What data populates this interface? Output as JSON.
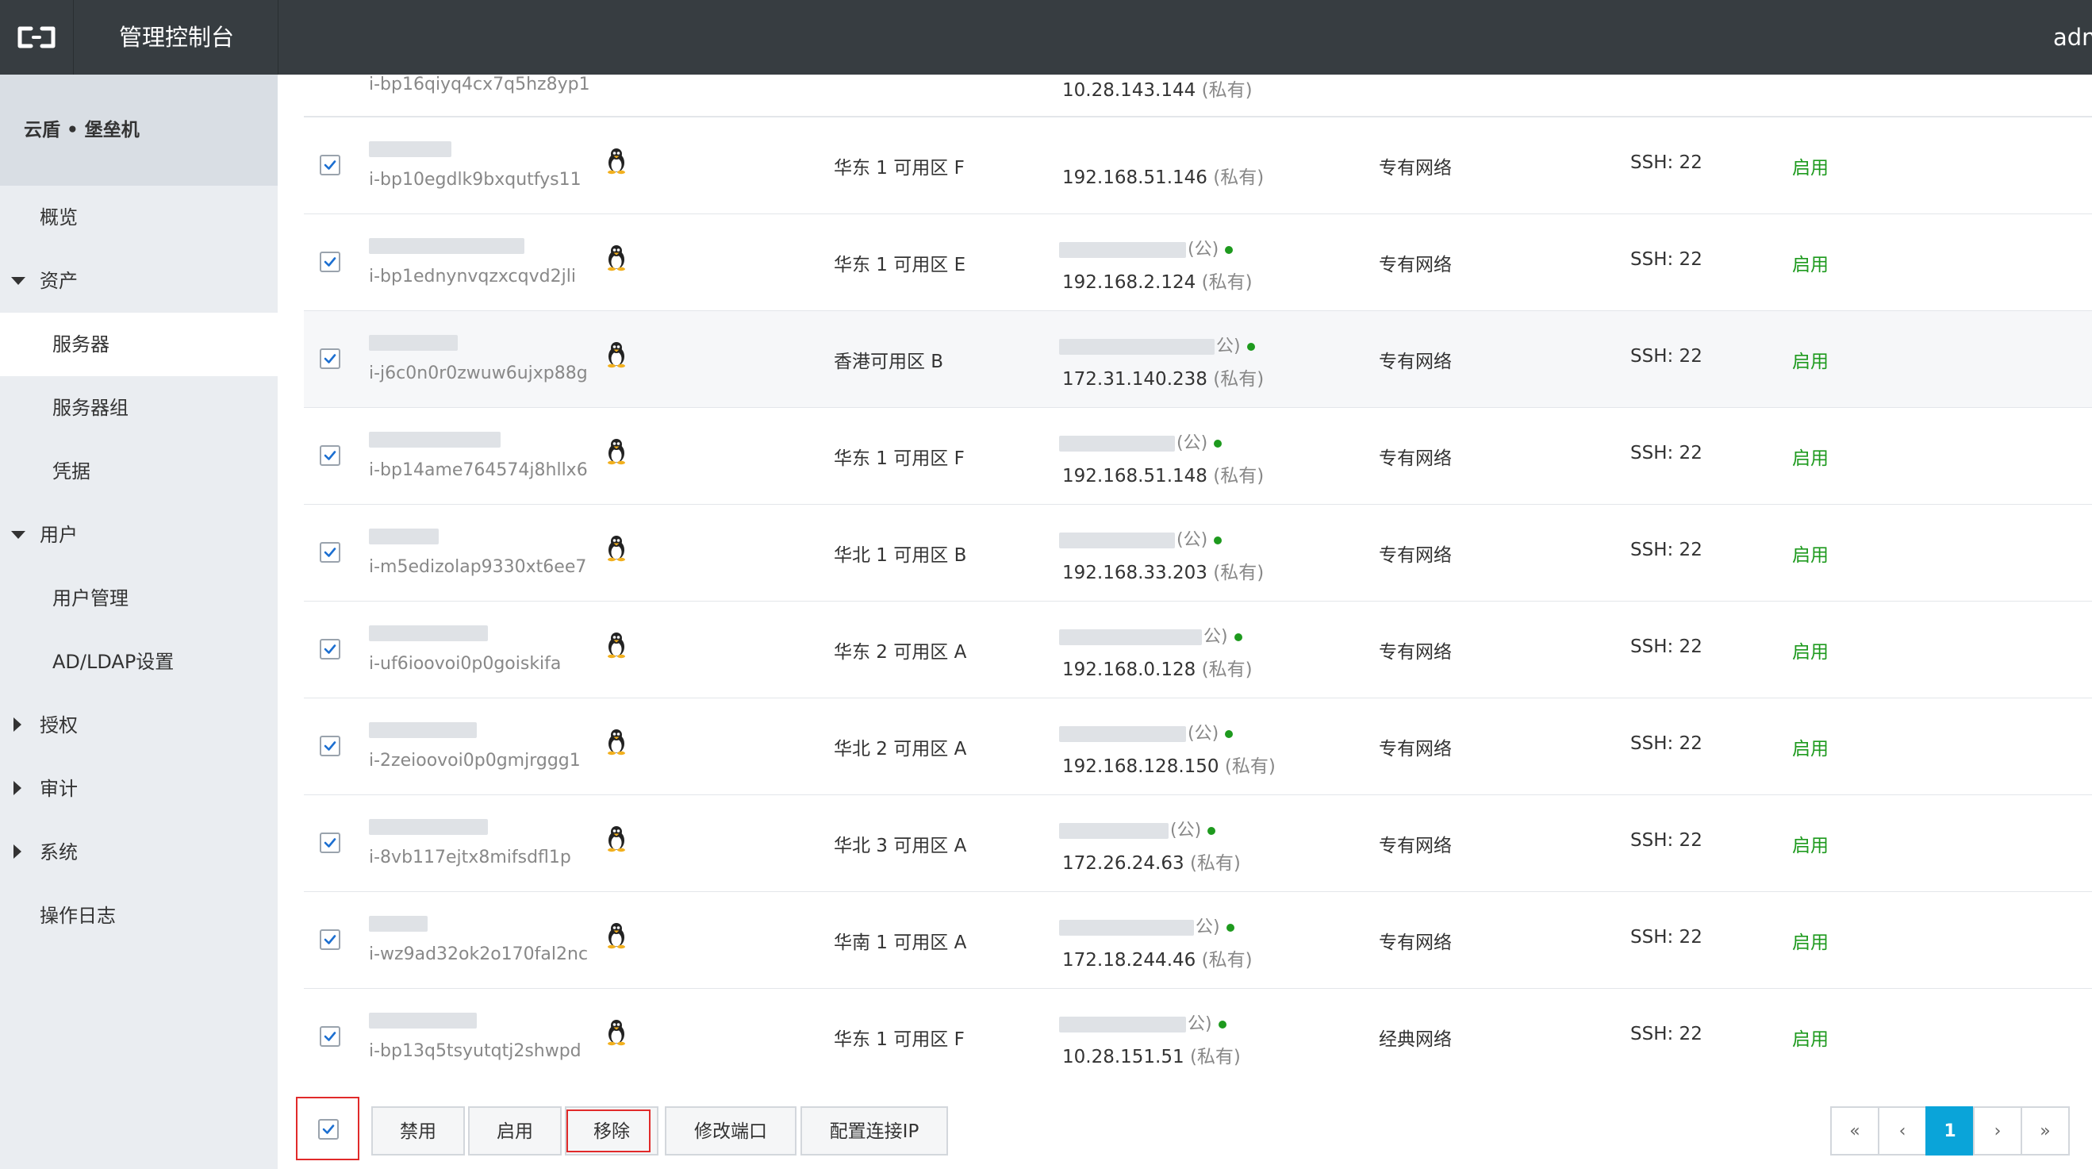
{
  "header": {
    "title": "管理控制台",
    "user": "adm"
  },
  "sidebar": {
    "product": "云盾 • 堡垒机",
    "items": [
      {
        "label": "概览"
      },
      {
        "label": "资产"
      },
      {
        "label": "服务器"
      },
      {
        "label": "服务器组"
      },
      {
        "label": "凭据"
      },
      {
        "label": "用户"
      },
      {
        "label": "用户管理"
      },
      {
        "label": "AD/LDAP设置"
      },
      {
        "label": "授权"
      },
      {
        "label": "审计"
      },
      {
        "label": "系统"
      },
      {
        "label": "操作日志"
      }
    ]
  },
  "table": {
    "partial_row": {
      "instance_id": "i-bp16qiyq4cx7q5hz8yp1",
      "private_ip": "10.28.143.144",
      "private_tag": "(私有)"
    },
    "rows": [
      {
        "instance_id": "i-bp10egdlk9bxqutfys11",
        "zone": "华东 1 可用区 F",
        "public_tag": "",
        "private_ip": "192.168.51.146",
        "private_tag": "(私有)",
        "network": "专有网络",
        "port": "SSH: 22",
        "status": "启用"
      },
      {
        "instance_id": "i-bp1ednynvqzxcqvd2jli",
        "zone": "华东 1 可用区 E",
        "public_tag": "(公)",
        "private_ip": "192.168.2.124",
        "private_tag": "(私有)",
        "network": "专有网络",
        "port": "SSH: 22",
        "status": "启用"
      },
      {
        "instance_id": "i-j6c0n0r0zwuw6ujxp88g",
        "zone": "香港可用区 B",
        "public_tag": "公)",
        "private_ip": "172.31.140.238",
        "private_tag": "(私有)",
        "network": "专有网络",
        "port": "SSH: 22",
        "status": "启用"
      },
      {
        "instance_id": "i-bp14ame764574j8hllx6",
        "zone": "华东 1 可用区 F",
        "public_tag": "(公)",
        "private_ip": "192.168.51.148",
        "private_tag": "(私有)",
        "network": "专有网络",
        "port": "SSH: 22",
        "status": "启用"
      },
      {
        "instance_id": "i-m5edizolap9330xt6ee7",
        "zone": "华北 1 可用区 B",
        "public_tag": "(公)",
        "private_ip": "192.168.33.203",
        "private_tag": "(私有)",
        "network": "专有网络",
        "port": "SSH: 22",
        "status": "启用"
      },
      {
        "instance_id": "i-uf6ioovoi0p0goiskifa",
        "zone": "华东 2 可用区 A",
        "public_tag": "公)",
        "private_ip": "192.168.0.128",
        "private_tag": "(私有)",
        "network": "专有网络",
        "port": "SSH: 22",
        "status": "启用"
      },
      {
        "instance_id": "i-2zeioovoi0p0gmjrggg1",
        "zone": "华北 2 可用区 A",
        "public_tag": "(公)",
        "private_ip": "192.168.128.150",
        "private_tag": "(私有)",
        "network": "专有网络",
        "port": "SSH: 22",
        "status": "启用"
      },
      {
        "instance_id": "i-8vb117ejtx8mifsdfl1p",
        "zone": "华北 3 可用区 A",
        "public_tag": "(公)",
        "private_ip": "172.26.24.63",
        "private_tag": "(私有)",
        "network": "专有网络",
        "port": "SSH: 22",
        "status": "启用"
      },
      {
        "instance_id": "i-wz9ad32ok2o170fal2nc",
        "zone": "华南 1 可用区 A",
        "public_tag": "公)",
        "private_ip": "172.18.244.46",
        "private_tag": "(私有)",
        "network": "专有网络",
        "port": "SSH: 22",
        "status": "启用"
      },
      {
        "instance_id": "i-bp13q5tsyutqtj2shwpd",
        "zone": "华东 1 可用区 F",
        "public_tag": "公)",
        "private_ip": "10.28.151.51",
        "private_tag": "(私有)",
        "network": "经典网络",
        "port": "SSH: 22",
        "status": "启用"
      }
    ]
  },
  "toolbar": {
    "disable_label": "禁用",
    "enable_label": "启用",
    "remove_label": "移除",
    "modify_port_label": "修改端口",
    "config_ip_label": "配置连接IP"
  },
  "pagination": {
    "first": "«",
    "prev": "‹",
    "current": "1",
    "next": "›",
    "last": "»"
  },
  "colors": {
    "topbar": "#373d41",
    "sidebar": "#eaedf1",
    "status_green": "#1e9a1e",
    "accent_blue": "#0aa4d9",
    "highlight_red": "#e12a2a"
  },
  "icons": [
    "console-logo-icon",
    "linux-penguin-icon",
    "checkbox-checked-icon",
    "caret-down-icon",
    "caret-right-icon"
  ]
}
